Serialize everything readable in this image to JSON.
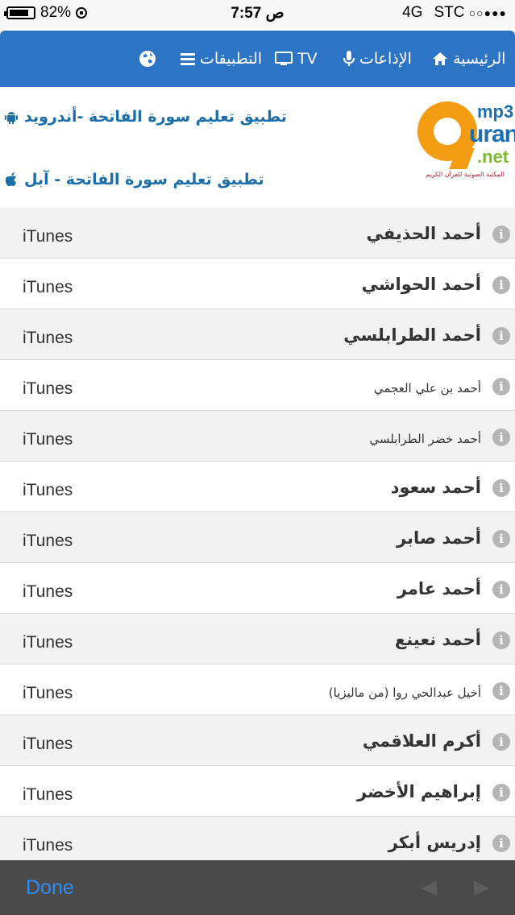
{
  "status_bar": {
    "battery": "82%",
    "battery_level": 0.82,
    "time": "7:57 ص",
    "network": "4G",
    "carrier": "STC",
    "signal": "○○●●●"
  },
  "nav": {
    "home": "الرئيسية",
    "radios": "الإذاعات",
    "tv": "TV",
    "apps": "التطبيقات",
    "accent_color": "#2d75c4"
  },
  "promo": {
    "android_link": "تطبيق تعليم سورة الفاتحة -أندرويد",
    "apple_link": "تطبيق تعليم سورة الفاتحة - آبل",
    "logo": {
      "mp3": "mp3",
      "uran": "uran",
      "net": ".net",
      "tagline": "المكتبة الصوتية للقرآن الكريم"
    }
  },
  "reciters": [
    {
      "name": "أحمد الحذيفي",
      "store": "iTunes",
      "small": false
    },
    {
      "name": "أحمد الحواشي",
      "store": "iTunes",
      "small": false
    },
    {
      "name": "أحمد الطرابلسي",
      "store": "iTunes",
      "small": false
    },
    {
      "name": "أحمد بن علي العجمي",
      "store": "iTunes",
      "small": true
    },
    {
      "name": "أحمد خضر الطرابلسي",
      "store": "iTunes",
      "small": true
    },
    {
      "name": "أحمد سعود",
      "store": "iTunes",
      "small": false
    },
    {
      "name": "أحمد صابر",
      "store": "iTunes",
      "small": false
    },
    {
      "name": "أحمد عامر",
      "store": "iTunes",
      "small": false
    },
    {
      "name": "أحمد نعينع",
      "store": "iTunes",
      "small": false
    },
    {
      "name": "أخيل عبدالحي روا (من ماليزيا)",
      "store": "iTunes",
      "small": true
    },
    {
      "name": "أكرم العلاقمي",
      "store": "iTunes",
      "small": false
    },
    {
      "name": "إبراهيم الأخضر",
      "store": "iTunes",
      "small": false
    },
    {
      "name": "إدريس أبكر",
      "store": "iTunes",
      "small": false
    }
  ],
  "toolbar": {
    "done": "Done"
  }
}
